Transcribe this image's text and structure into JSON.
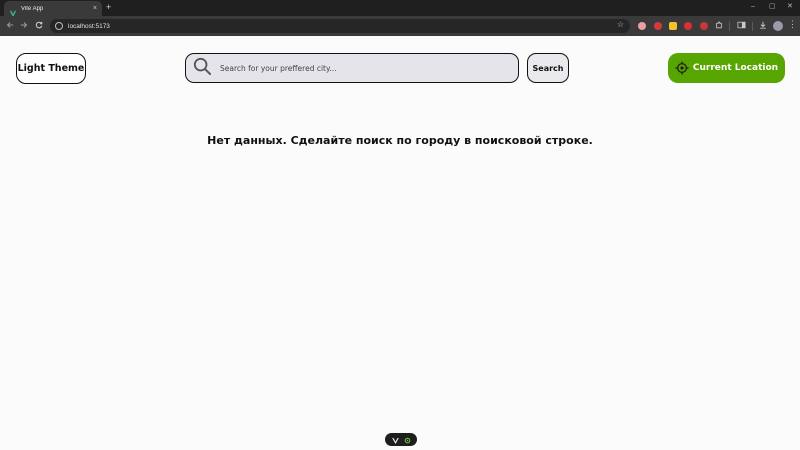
{
  "browser": {
    "tab_title": "Vite App",
    "close_glyph": "×",
    "new_tab_glyph": "+",
    "url": "localhost:5173",
    "window_controls": [
      "–",
      "▢",
      "✕"
    ],
    "icons": [
      "vite-favicon-icon",
      "back-arrow-icon",
      "forward-arrow-icon",
      "reload-icon",
      "site-info-icon",
      "bookmark-star-icon",
      "extensions-icon",
      "download-icon",
      "profile-avatar",
      "menu-kebab-icon"
    ],
    "extension_colors": [
      "#e8a0a0",
      "#d33b3b",
      "#f2c230",
      "#d93131",
      "#c93838"
    ]
  },
  "app": {
    "theme_button_label": "Light Theme",
    "search_placeholder": "Search for your preffered city...",
    "search_value": "",
    "search_button_label": "Search",
    "location_button_label": "Current Location",
    "empty_message": "Нет данных. Сделайте поиск по городу в поисковой строке.",
    "accent_color": "#57a500"
  },
  "devtools": {
    "icons": [
      "vue-logo-icon",
      "devtools-gear-icon"
    ]
  }
}
